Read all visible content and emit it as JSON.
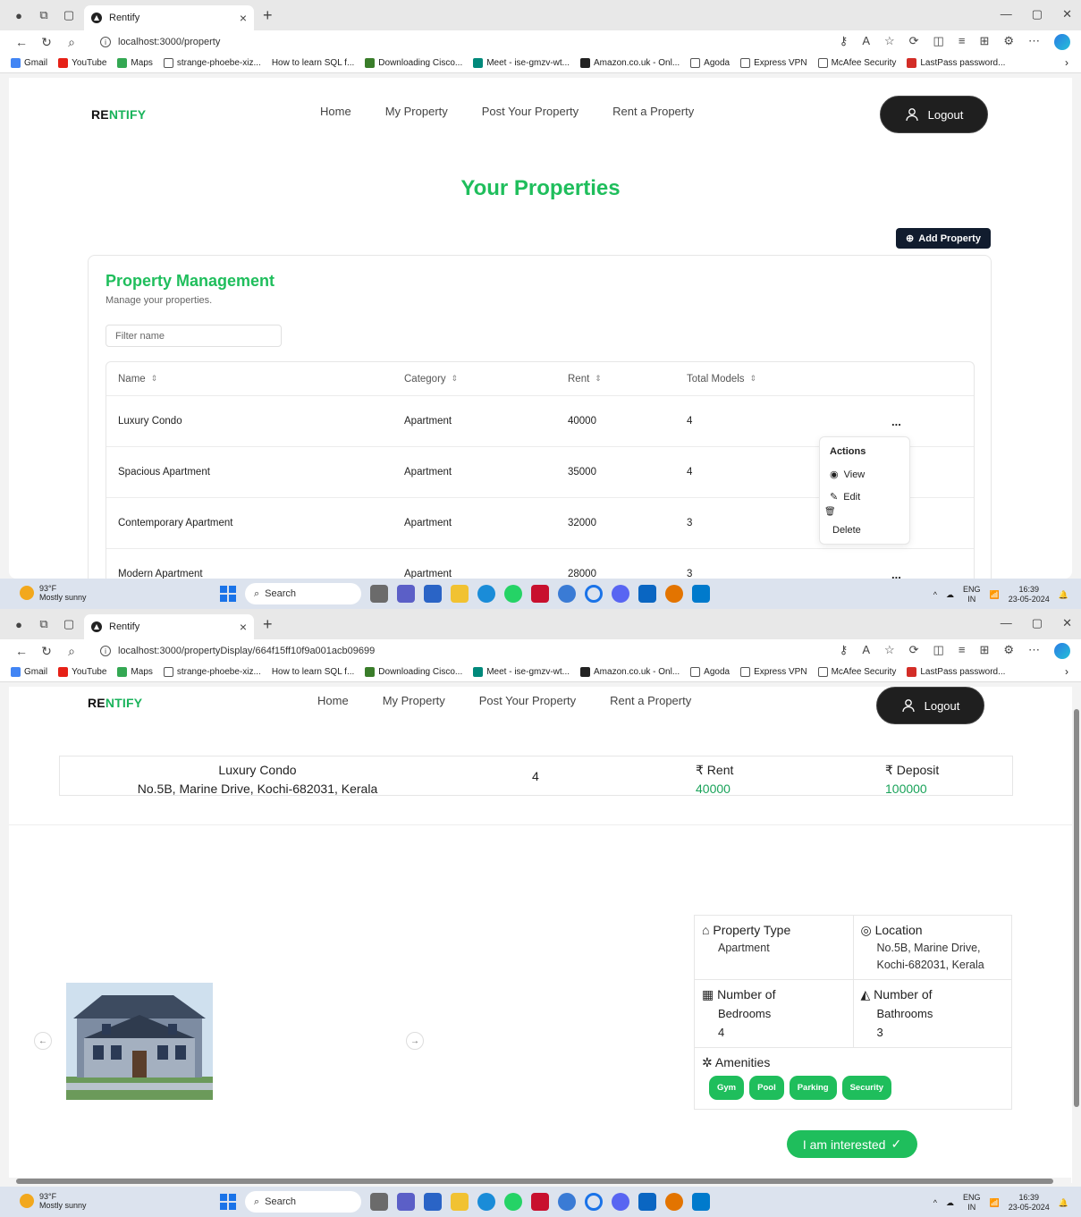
{
  "browser": {
    "tab_title": "Rentify",
    "url1": "localhost:3000/property",
    "url2": "localhost:3000/propertyDisplay/664f15ff10f9a001acb09699",
    "bookmarks": [
      "Gmail",
      "YouTube",
      "Maps",
      "strange-phoebe-xiz...",
      "How to learn SQL f...",
      "Downloading Cisco...",
      "Meet - ise-gmzv-wt...",
      "Amazon.co.uk - Onl...",
      "Agoda",
      "Express VPN",
      "McAfee Security",
      "LastPass password..."
    ]
  },
  "nav": {
    "brand_a": "RE",
    "brand_b": "NTIFY",
    "links": [
      "Home",
      "My Property",
      "Post Your Property",
      "Rent a Property"
    ],
    "logout": "Logout"
  },
  "page1": {
    "heading": "Your Properties",
    "add_property": "Add Property",
    "card_title": "Property Management",
    "card_subtitle": "Manage your properties.",
    "filter_placeholder": "Filter name",
    "columns": [
      "Name",
      "Category",
      "Rent",
      "Total Models"
    ],
    "rows": [
      {
        "name": "Luxury Condo",
        "category": "Apartment",
        "rent": "40000",
        "models": "4"
      },
      {
        "name": "Spacious Apartment",
        "category": "Apartment",
        "rent": "35000",
        "models": "4"
      },
      {
        "name": "Contemporary Apartment",
        "category": "Apartment",
        "rent": "32000",
        "models": "3"
      },
      {
        "name": "Modern Apartment",
        "category": "Apartment",
        "rent": "28000",
        "models": "3"
      }
    ],
    "row_menu": "...",
    "menu": {
      "title": "Actions",
      "view": "View",
      "edit": "Edit",
      "delete": "Delete"
    }
  },
  "page2": {
    "name": "Luxury Condo",
    "address": "No.5B, Marine Drive, Kochi-682031, Kerala",
    "count": "4",
    "rent_label": "₹ Rent",
    "rent": "40000",
    "deposit_label": "₹ Deposit",
    "deposit": "100000",
    "property_type_label": "Property Type",
    "property_type": "Apartment",
    "location_label": "Location",
    "location_line1": "No.5B, Marine Drive,",
    "location_line2": "Kochi-682031, Kerala",
    "bedrooms_label_1": "Number of",
    "bedrooms_label_2": "Bedrooms",
    "bedrooms": "4",
    "bathrooms_label_1": "Number of",
    "bathrooms_label_2": "Bathrooms",
    "bathrooms": "3",
    "amenities_label": "Amenities",
    "amenities": [
      "Gym",
      "Pool",
      "Parking",
      "Security"
    ],
    "interested": "I am interested"
  },
  "taskbar": {
    "temp": "93°F",
    "weather": "Mostly sunny",
    "search": "Search",
    "lang1": "ENG",
    "lang2": "IN",
    "time": "16:39",
    "date": "23-05-2024"
  },
  "colors": {
    "accent": "#1fbe5c",
    "dark": "#1f1f1f"
  }
}
